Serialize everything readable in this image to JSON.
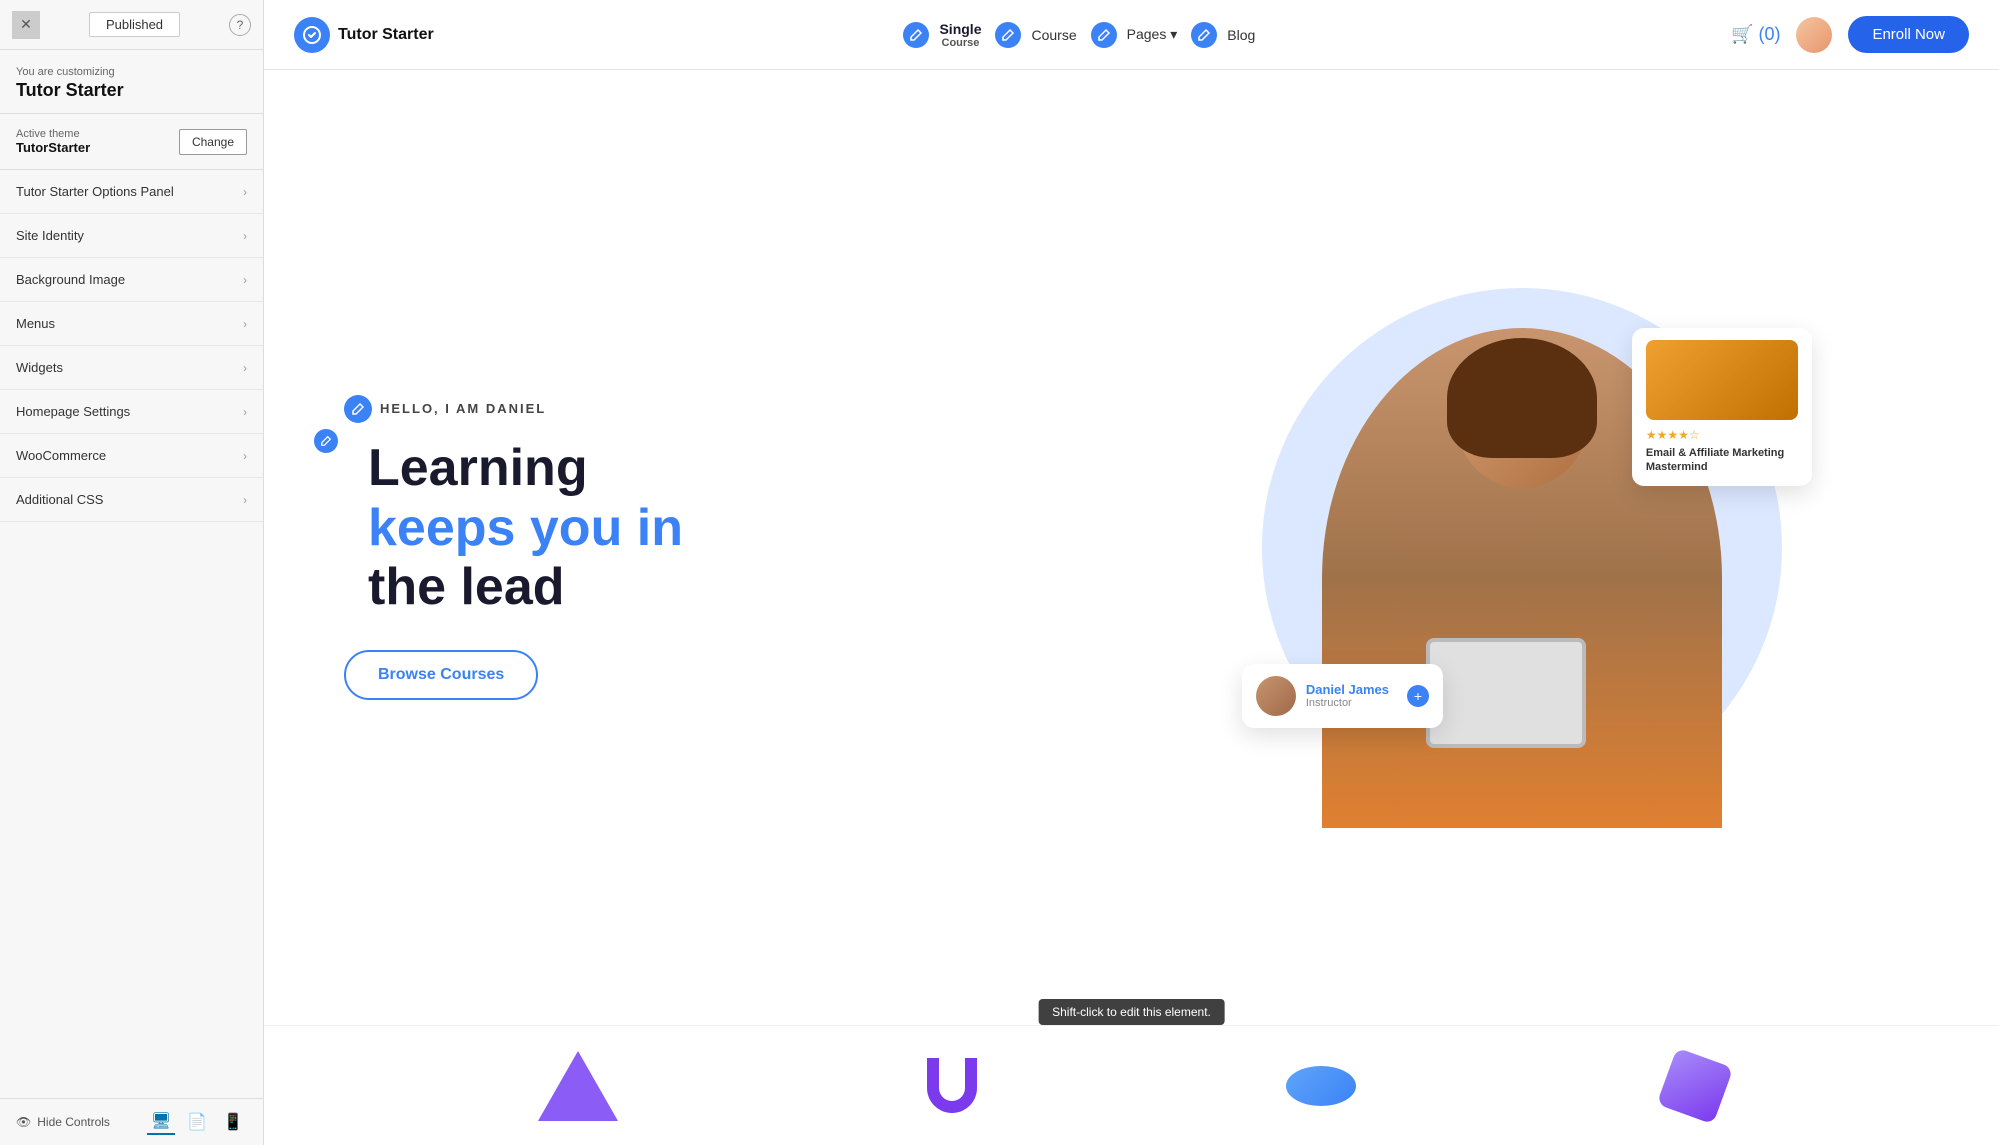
{
  "leftPanel": {
    "closeLabel": "✕",
    "publishedLabel": "Published",
    "helpLabel": "?",
    "customizingLabel": "You are customizing",
    "customizingTitle": "Tutor Starter",
    "activeThemeLabel": "Active theme",
    "activeThemeName": "TutorStarter",
    "changeButtonLabel": "Change",
    "navItems": [
      {
        "label": "Tutor Starter Options Panel",
        "id": "tutor-starter-options"
      },
      {
        "label": "Site Identity",
        "id": "site-identity"
      },
      {
        "label": "Background Image",
        "id": "background-image"
      },
      {
        "label": "Menus",
        "id": "menus"
      },
      {
        "label": "Widgets",
        "id": "widgets"
      },
      {
        "label": "Homepage Settings",
        "id": "homepage-settings"
      },
      {
        "label": "WooCommerce",
        "id": "woocommerce"
      },
      {
        "label": "Additional CSS",
        "id": "additional-css"
      }
    ],
    "hideControlsLabel": "Hide Controls"
  },
  "topNav": {
    "brandName": "Tutor Starter",
    "links": [
      {
        "label": "Single",
        "sub": "Course",
        "active": true
      },
      {
        "label": "Course",
        "active": false
      },
      {
        "label": "Pages",
        "active": false,
        "hasDropdown": true
      },
      {
        "label": "Blog",
        "active": false
      }
    ],
    "cartLabel": "🛒 (0)",
    "enrollLabel": "Enroll Now"
  },
  "hero": {
    "helloTag": "HELLO, I AM DANIEL",
    "headingLine1": "Learning",
    "headingLine2": "keeps you in",
    "headingLine3": "the lead",
    "highlightLine": "keeps you in",
    "browseBtnLabel": "Browse Courses",
    "instructorName": "Daniel James",
    "instructorRole": "Instructor",
    "courseCardTitle": "Email & Affiliate Marketing Mastermind",
    "stars": "★★★★☆",
    "tooltip": "Shift-click to edit this element."
  },
  "shapes": [
    {
      "color": "#7c5cbf",
      "type": "triangle"
    },
    {
      "color": "#8b5cf6",
      "type": "hook"
    },
    {
      "color": "#4f9ef0",
      "type": "disc"
    },
    {
      "color": "#a78bfa",
      "type": "cube"
    }
  ]
}
